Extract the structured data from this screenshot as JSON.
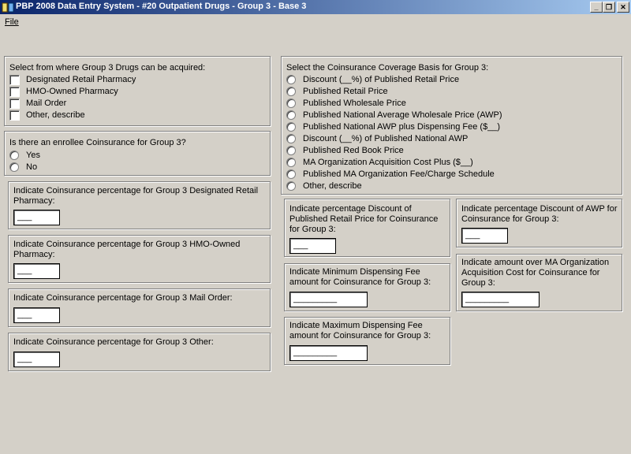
{
  "window": {
    "title": "PBP 2008 Data Entry System - #20 Outpatient Drugs - Group 3 - Base 3",
    "minimize": "_",
    "restore": "❐",
    "close": "✕"
  },
  "menu": {
    "file": "File"
  },
  "acquire": {
    "prompt": "Select from where Group 3 Drugs can be acquired:",
    "options": [
      "Designated Retail Pharmacy",
      "HMO-Owned Pharmacy",
      "Mail Order",
      "Other, describe"
    ]
  },
  "enrollee": {
    "prompt": "Is there an enrollee Coinsurance for Group 3?",
    "options": [
      "Yes",
      "No"
    ]
  },
  "pct_retail": {
    "label": "Indicate Coinsurance percentage for Group 3 Designated Retail Pharmacy:",
    "value": "___"
  },
  "pct_hmo": {
    "label": "Indicate Coinsurance percentage for Group 3 HMO-Owned Pharmacy:",
    "value": "___"
  },
  "pct_mail": {
    "label": "Indicate Coinsurance percentage for Group 3 Mail Order:",
    "value": "___"
  },
  "pct_other": {
    "label": "Indicate Coinsurance percentage for Group 3 Other:",
    "value": "___"
  },
  "basis": {
    "prompt": "Select the Coinsurance Coverage Basis for Group 3:",
    "options": [
      "Discount (__%) of Published Retail Price",
      "Published Retail Price",
      "Published Wholesale Price",
      "Published National Average Wholesale Price (AWP)",
      "Published National AWP plus Dispensing Fee ($__)",
      "Discount (__%) of Published National AWP",
      "Published Red Book Price",
      "MA Organization Acquisition Cost Plus ($__)",
      "Published MA Organization Fee/Charge Schedule",
      "Other, describe"
    ]
  },
  "disc_retail": {
    "label": "Indicate percentage Discount of Published Retail Price for Coinsurance for Group 3:",
    "value": "___"
  },
  "disc_awp": {
    "label": "Indicate percentage Discount of AWP for Coinsurance for Group 3:",
    "value": "___"
  },
  "min_fee": {
    "label": "Indicate Minimum Dispensing Fee amount for Coinsurance for Group 3:",
    "value": "_________"
  },
  "max_fee": {
    "label": "Indicate Maximum Dispensing Fee amount for Coinsurance for Group 3:",
    "value": "_________"
  },
  "ma_cost": {
    "label": "Indicate amount over MA Organization Acquisition Cost for Coinsurance for Group 3:",
    "value": "_________"
  }
}
